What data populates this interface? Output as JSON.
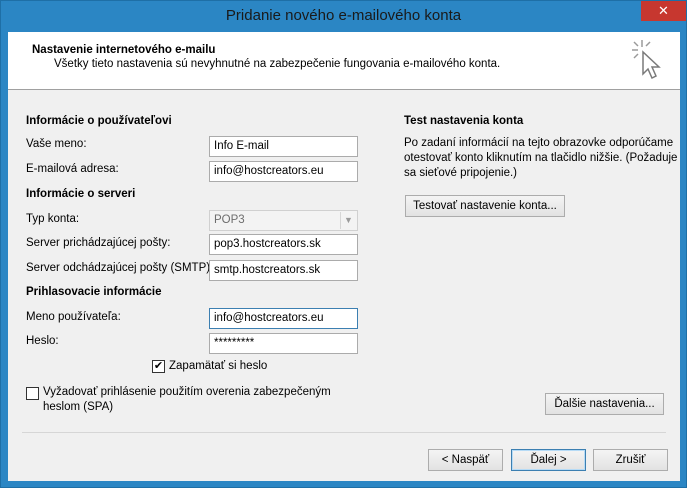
{
  "window": {
    "title": "Pridanie nového e-mailového konta",
    "close_glyph": "✕"
  },
  "header": {
    "title": "Nastavenie internetového e-mailu",
    "subtitle": "Všetky tieto nastavenia sú nevyhnutné na zabezpečenie fungovania e-mailového konta."
  },
  "user_info": {
    "section_title": "Informácie o používateľovi",
    "name_label": "Vaše meno:",
    "name_value": "Info E-mail",
    "email_label": "E-mailová adresa:",
    "email_value": "info@hostcreators.eu"
  },
  "server_info": {
    "section_title": "Informácie o serveri",
    "account_type_label": "Typ konta:",
    "account_type_value": "POP3",
    "incoming_label": "Server prichádzajúcej pošty:",
    "incoming_value": "pop3.hostcreators.sk",
    "outgoing_label": "Server odchádzajúcej pošty (SMTP):",
    "outgoing_value": "smtp.hostcreators.sk"
  },
  "login_info": {
    "section_title": "Prihlasovacie informácie",
    "username_label": "Meno používateľa:",
    "username_value": "info@hostcreators.eu",
    "password_label": "Heslo:",
    "password_value": "*********",
    "remember_label": "Zapamätať si heslo",
    "remember_checked": true
  },
  "spa": {
    "label_line1": "Vyžadovať prihlásenie použitím overenia zabezpečeným",
    "label_line2": "heslom (SPA)",
    "checked": false
  },
  "test": {
    "section_title": "Test nastavenia konta",
    "description_line1": "Po zadaní informácií na tejto obrazovke odporúčame",
    "description_line2": "otestovať konto kliknutím na tlačidlo nižšie. (Požaduje",
    "description_line3": "sa sieťové pripojenie.)",
    "button_label": "Testovať nastavenie konta..."
  },
  "more_settings_label": "Ďalšie nastavenia...",
  "footer": {
    "back_label": "< Naspäť",
    "next_label": "Ďalej >",
    "cancel_label": "Zrušiť"
  },
  "checkmark_glyph": "✔",
  "dropdown_glyph": "▼",
  "colors": {
    "titlebar": "#2b86c4",
    "close_button": "#c7372f",
    "client_bg": "#f0f0f0",
    "focus_border": "#3c7fb1"
  }
}
